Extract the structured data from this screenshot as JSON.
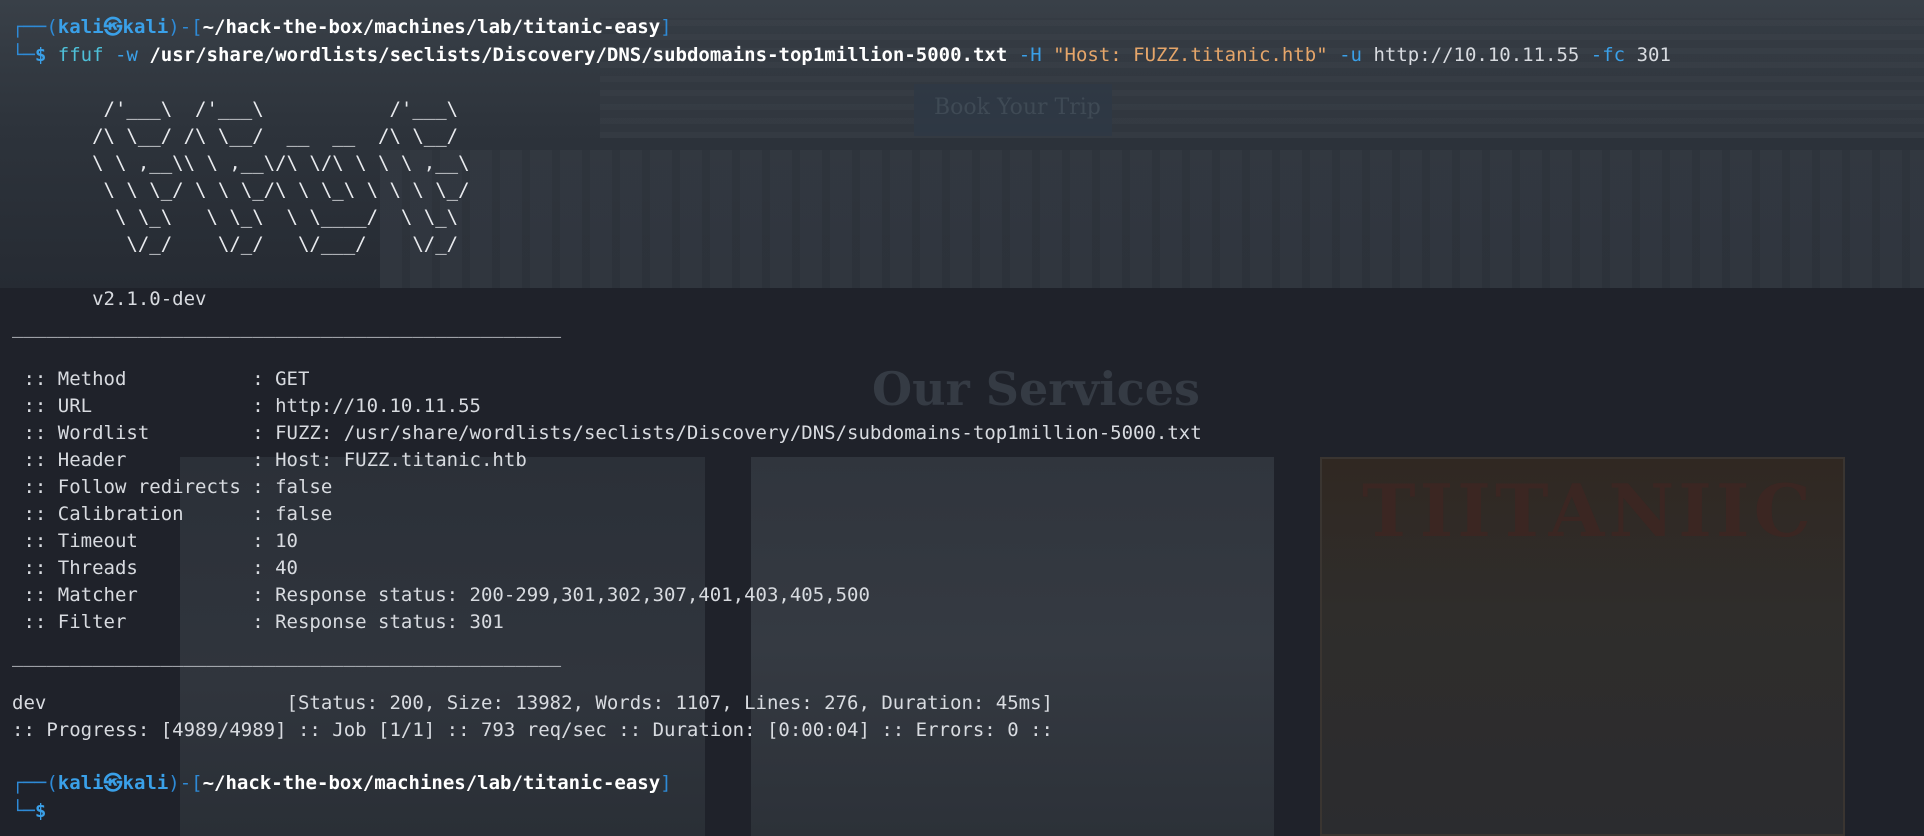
{
  "background": {
    "button_label": "Book Your Trip",
    "heading": "Our Services",
    "card_logo": "TIITANIIC"
  },
  "prompt": {
    "frame_top": "┌──(",
    "user": "kali㉿kali",
    "frame_mid": ")-[",
    "path": "~/hack-the-box/machines/lab/titanic-easy",
    "frame_end": "]",
    "frame_bottom": "└─",
    "symbol": "$"
  },
  "command": {
    "program": "ffuf",
    "flag_w": "-w",
    "wordlist": "/usr/share/wordlists/seclists/Discovery/DNS/subdomains-top1million-5000.txt",
    "flag_h": "-H",
    "header": "\"Host: FUZZ.titanic.htb\"",
    "flag_u": "-u",
    "url": "http://10.10.11.55",
    "flag_fc": "-fc",
    "fc_value": "301"
  },
  "banner": [
    "        /'___\\  /'___\\           /'___\\",
    "       /\\ \\__/ /\\ \\__/  __  __  /\\ \\__/",
    "       \\ \\ ,__\\\\ \\ ,__\\/\\ \\/\\ \\ \\ \\ ,__\\",
    "        \\ \\ \\_/ \\ \\ \\_/\\ \\ \\_\\ \\ \\ \\ \\_/",
    "         \\ \\_\\   \\ \\_\\  \\ \\____/  \\ \\_\\",
    "          \\/_/    \\/_/   \\/___/    \\/_/"
  ],
  "version": "       v2.1.0-dev",
  "separator": "________________________________________________",
  "config": [
    {
      "key": " :: Method           ",
      "value": ": GET"
    },
    {
      "key": " :: URL              ",
      "value": ": http://10.10.11.55"
    },
    {
      "key": " :: Wordlist         ",
      "value": ": FUZZ: /usr/share/wordlists/seclists/Discovery/DNS/subdomains-top1million-5000.txt"
    },
    {
      "key": " :: Header           ",
      "value": ": Host: FUZZ.titanic.htb"
    },
    {
      "key": " :: Follow redirects ",
      "value": ": false"
    },
    {
      "key": " :: Calibration      ",
      "value": ": false"
    },
    {
      "key": " :: Timeout          ",
      "value": ": 10"
    },
    {
      "key": " :: Threads          ",
      "value": ": 40"
    },
    {
      "key": " :: Matcher          ",
      "value": ": Response status: 200-299,301,302,307,401,403,405,500"
    },
    {
      "key": " :: Filter           ",
      "value": ": Response status: 301"
    }
  ],
  "result": {
    "name": "dev                     ",
    "details": "[Status: 200, Size: 13982, Words: 1107, Lines: 276, Duration: 45ms]"
  },
  "progress": ":: Progress: [4989/4989] :: Job [1/1] :: 793 req/sec :: Duration: [0:00:04] :: Errors: 0 ::"
}
